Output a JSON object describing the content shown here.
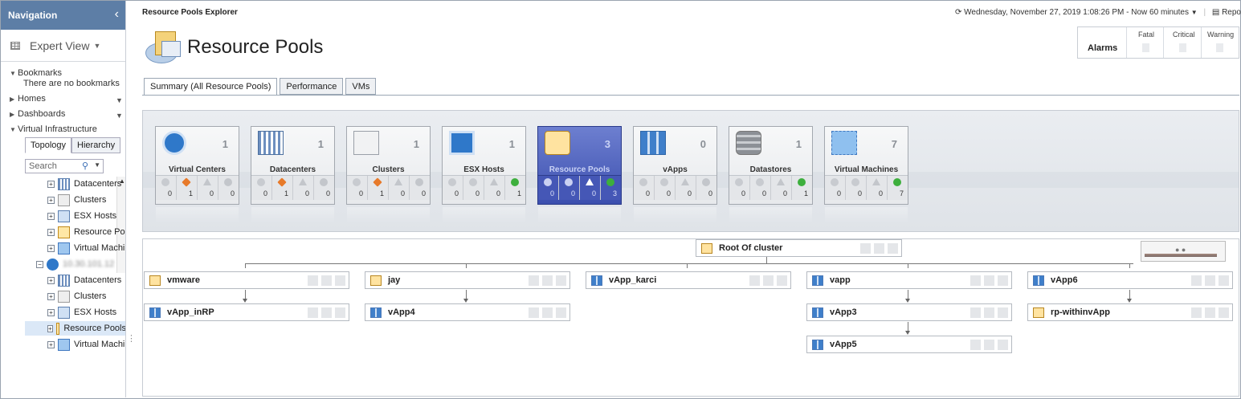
{
  "nav": {
    "title": "Navigation",
    "view_label": "Expert View",
    "bookmarks_label": "Bookmarks",
    "bookmarks_empty": "There are no bookmarks",
    "homes_label": "Homes",
    "dashboards_label": "Dashboards",
    "vi_label": "Virtual Infrastructure",
    "tabs": [
      "Topology",
      "Hierarchy"
    ],
    "search_placeholder": "Search",
    "tree": [
      {
        "label": "Datacenters",
        "icon": "datacenter-icon"
      },
      {
        "label": "Clusters",
        "icon": "cluster-icon"
      },
      {
        "label": "ESX Hosts",
        "icon": "esx-host-icon"
      },
      {
        "label": "Resource Pools",
        "icon": "resource-pool-icon"
      },
      {
        "label": "Virtual Machines",
        "icon": "vm-icon"
      },
      {
        "label": "10.30.101.12",
        "icon": "virtual-center-icon"
      },
      {
        "label": "Datacenters",
        "icon": "datacenter-icon"
      },
      {
        "label": "Clusters",
        "icon": "cluster-icon"
      },
      {
        "label": "ESX Hosts",
        "icon": "esx-host-icon"
      },
      {
        "label": "Resource Pools",
        "icon": "resource-pool-icon"
      },
      {
        "label": "Virtual Machines",
        "icon": "vm-icon"
      }
    ]
  },
  "header": {
    "app_title": "Resource Pools Explorer",
    "time_text": "Wednesday, November 27, 2019 1:08:26 PM - Now 60 minutes",
    "reports_label": "Reports",
    "page_title": "Resource Pools"
  },
  "alarms": {
    "label": "Alarms",
    "columns": [
      "Fatal",
      "Critical",
      "Warning"
    ]
  },
  "tabs": [
    "Summary (All Resource Pools)",
    "Performance",
    "VMs"
  ],
  "tiles": [
    {
      "name": "Virtual Centers",
      "count": "1",
      "stats": [
        "0",
        "1",
        "0",
        "0"
      ],
      "ok": false
    },
    {
      "name": "Datacenters",
      "count": "1",
      "stats": [
        "0",
        "1",
        "0",
        "0"
      ],
      "ok": false
    },
    {
      "name": "Clusters",
      "count": "1",
      "stats": [
        "0",
        "1",
        "0",
        "0"
      ],
      "ok": false
    },
    {
      "name": "ESX Hosts",
      "count": "1",
      "stats": [
        "0",
        "0",
        "0",
        "1"
      ],
      "ok": true
    },
    {
      "name": "Resource Pools",
      "count": "3",
      "stats": [
        "0",
        "0",
        "0",
        "3"
      ],
      "ok": true
    },
    {
      "name": "vApps",
      "count": "0",
      "stats": [
        "0",
        "0",
        "0",
        "0"
      ],
      "ok": false
    },
    {
      "name": "Datastores",
      "count": "1",
      "stats": [
        "0",
        "0",
        "0",
        "1"
      ],
      "ok": true
    },
    {
      "name": "Virtual Machines",
      "count": "7",
      "stats": [
        "0",
        "0",
        "0",
        "7"
      ],
      "ok": true
    }
  ],
  "topology": {
    "root": "Root Of cluster",
    "nodes": [
      "vmware",
      "jay",
      "vApp_karci",
      "vapp",
      "vApp6",
      "vApp_inRP",
      "vApp4",
      "vApp3",
      "rp-withinvApp",
      "vApp5"
    ]
  },
  "colors": {
    "nav_header": "#5d7ea6",
    "selected_tile": "#4557b6",
    "critical": "#e77a2a",
    "ok": "#3daf3d"
  }
}
